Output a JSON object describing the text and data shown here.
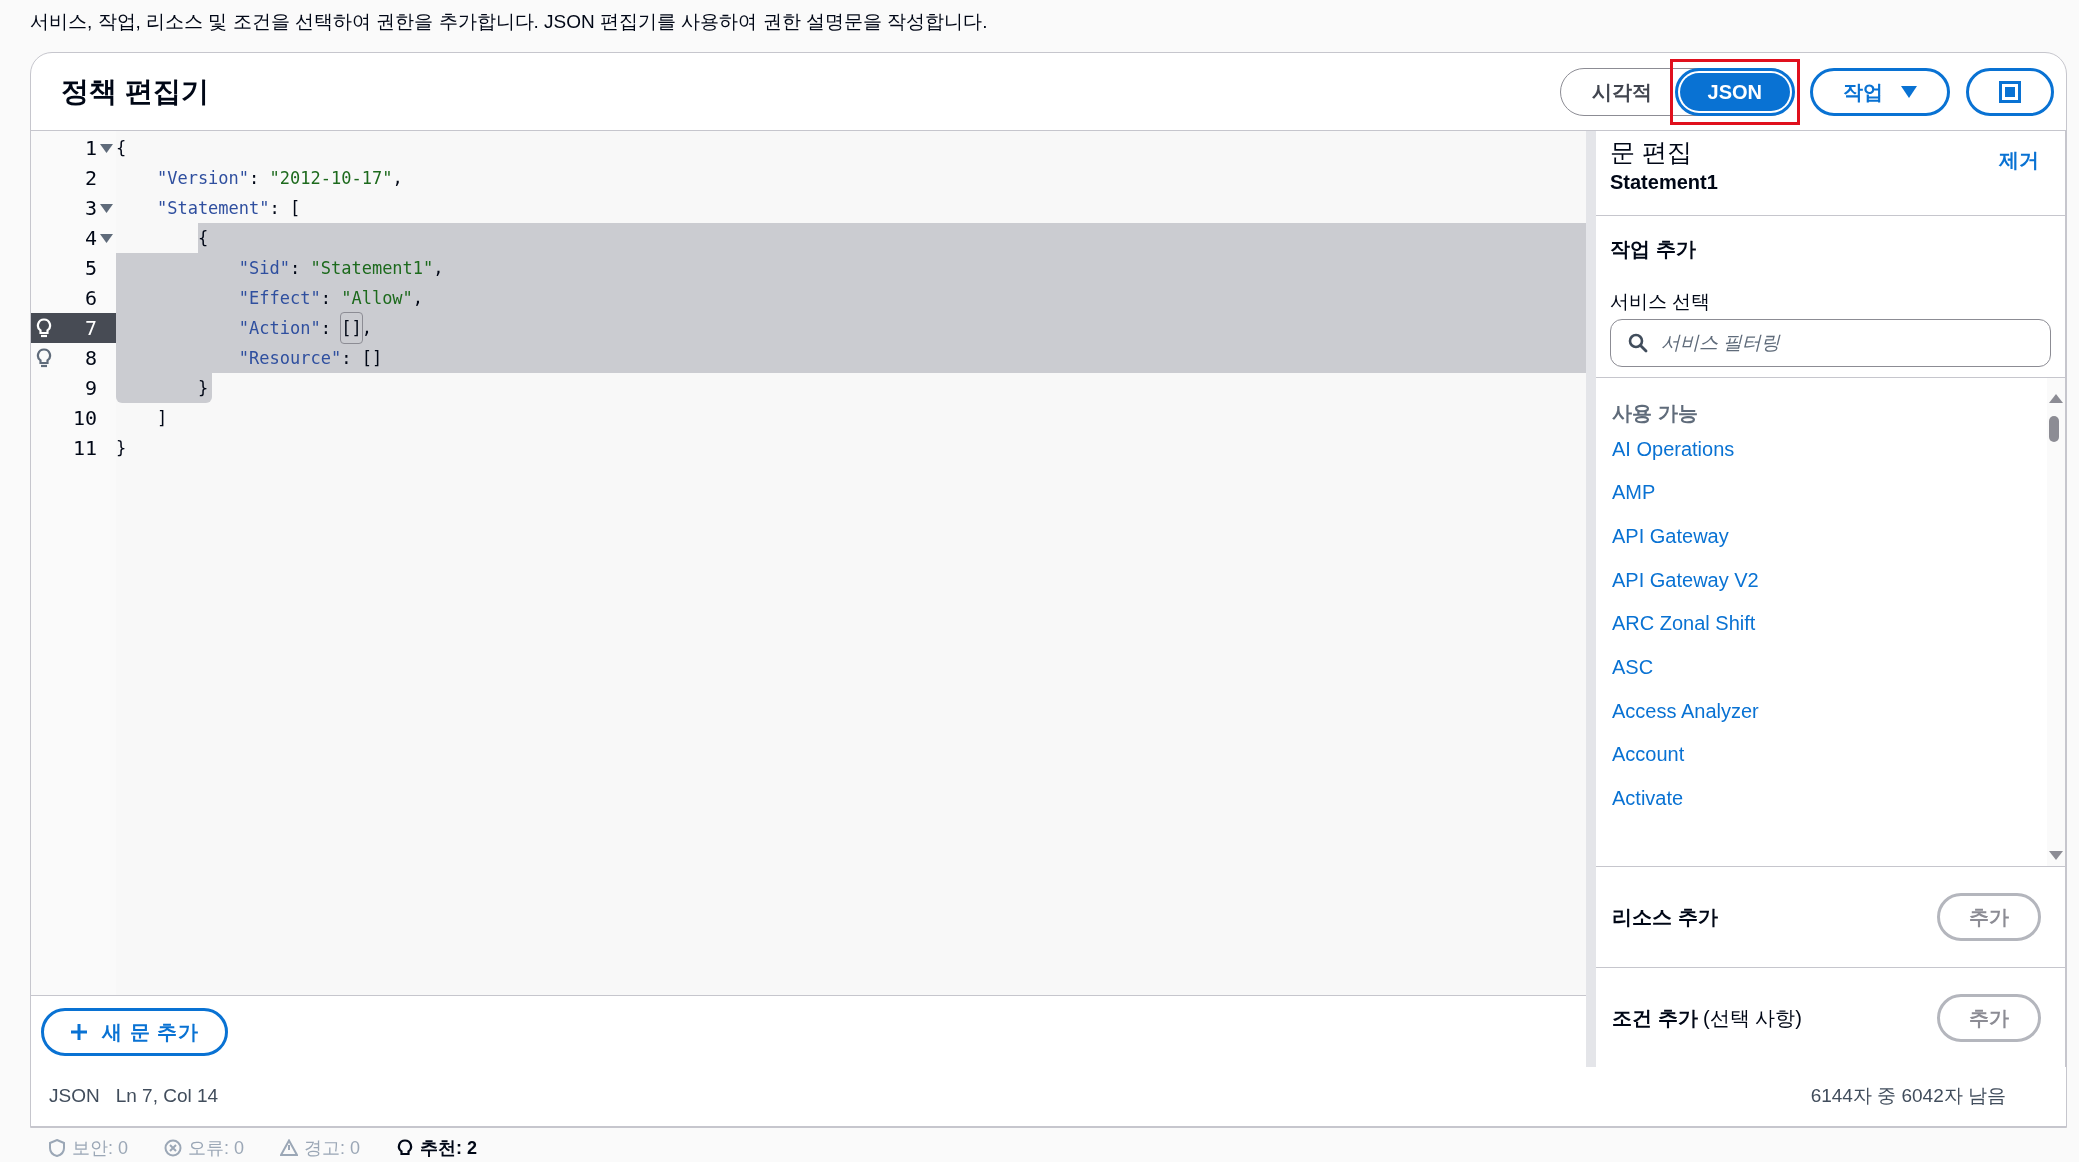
{
  "description": "서비스, 작업, 리소스 및 조건을 선택하여 권한을 추가합니다. JSON 편집기를 사용하여 권한 설명문을 작성합니다.",
  "editor": {
    "title": "정책 편집기",
    "mode_toggle": [
      {
        "label": "시각적",
        "selected": false,
        "highlighted": false
      },
      {
        "label": "JSON",
        "selected": true,
        "highlighted": true
      }
    ],
    "actions_button": "작업",
    "code_lines": [
      {
        "number": "1",
        "foldable": true,
        "hint": false,
        "current": false,
        "selected": false,
        "tokens": [
          {
            "kind": "plain",
            "text": "{"
          }
        ]
      },
      {
        "number": "2",
        "foldable": false,
        "hint": false,
        "current": false,
        "selected": false,
        "tokens": [
          {
            "kind": "key",
            "text": "    \"Version\""
          },
          {
            "kind": "plain",
            "text": ": "
          },
          {
            "kind": "string",
            "text": "\"2012-10-17\""
          },
          {
            "kind": "plain",
            "text": ","
          }
        ]
      },
      {
        "number": "3",
        "foldable": true,
        "hint": false,
        "current": false,
        "selected": false,
        "tokens": [
          {
            "kind": "key",
            "text": "    \"Statement\""
          },
          {
            "kind": "plain",
            "text": ": ["
          }
        ]
      },
      {
        "number": "4",
        "foldable": true,
        "hint": false,
        "current": false,
        "selected": true,
        "tokens": [
          {
            "kind": "plain",
            "text": "        {"
          }
        ]
      },
      {
        "number": "5",
        "foldable": false,
        "hint": false,
        "current": false,
        "selected": true,
        "tokens": [
          {
            "kind": "key",
            "text": "            \"Sid\""
          },
          {
            "kind": "plain",
            "text": ": "
          },
          {
            "kind": "string",
            "text": "\"Statement1\""
          },
          {
            "kind": "plain",
            "text": ","
          }
        ]
      },
      {
        "number": "6",
        "foldable": false,
        "hint": false,
        "current": false,
        "selected": true,
        "tokens": [
          {
            "kind": "key",
            "text": "            \"Effect\""
          },
          {
            "kind": "plain",
            "text": ": "
          },
          {
            "kind": "string",
            "text": "\"Allow\""
          },
          {
            "kind": "plain",
            "text": ","
          }
        ]
      },
      {
        "number": "7",
        "foldable": false,
        "hint": true,
        "current": true,
        "selected": true,
        "tokens": [
          {
            "kind": "key",
            "text": "            \"Action\""
          },
          {
            "kind": "plain",
            "text": ": "
          },
          {
            "kind": "matched",
            "text": "[]"
          },
          {
            "kind": "plain",
            "text": ","
          }
        ]
      },
      {
        "number": "8",
        "foldable": false,
        "hint": true,
        "current": false,
        "selected": true,
        "tokens": [
          {
            "kind": "key",
            "text": "            \"Resource\""
          },
          {
            "kind": "plain",
            "text": ": []"
          }
        ]
      },
      {
        "number": "9",
        "foldable": false,
        "hint": false,
        "current": false,
        "selected": true,
        "tokens": [
          {
            "kind": "plain",
            "text": "        }"
          }
        ]
      },
      {
        "number": "10",
        "foldable": false,
        "hint": false,
        "current": false,
        "selected": false,
        "tokens": [
          {
            "kind": "plain",
            "text": "    ]"
          }
        ]
      },
      {
        "number": "11",
        "foldable": false,
        "hint": false,
        "current": false,
        "selected": false,
        "tokens": [
          {
            "kind": "plain",
            "text": "}"
          }
        ]
      }
    ],
    "add_statement_button": "새 문 추가",
    "status_bar": {
      "language": "JSON",
      "cursor": "Ln 7, Col 14",
      "remaining": "6144자 중 6042자 남음"
    },
    "findings": [
      {
        "kind": "security",
        "label": "보안: 0",
        "emphasized": false
      },
      {
        "kind": "error",
        "label": "오류: 0",
        "emphasized": false
      },
      {
        "kind": "warning",
        "label": "경고: 0",
        "emphasized": false
      },
      {
        "kind": "suggestion",
        "label": "추천: 2",
        "emphasized": true
      }
    ]
  },
  "statement_panel": {
    "title": "문 편집",
    "statement_name": "Statement1",
    "remove_link": "제거",
    "add_actions": {
      "heading": "작업 추가",
      "service_label": "서비스 선택",
      "search": {
        "placeholder": "서비스 필터링"
      },
      "group_label": "사용 가능",
      "services": [
        "AI Operations",
        "AMP",
        "API Gateway",
        "API Gateway V2",
        "ARC Zonal Shift",
        "ASC",
        "Access Analyzer",
        "Account",
        "Activate"
      ]
    },
    "add_resources": {
      "heading": "리소스 추가",
      "button": "추가"
    },
    "add_conditions": {
      "heading": "**조건 추가** (선택 사항)",
      "button": "추가"
    }
  }
}
